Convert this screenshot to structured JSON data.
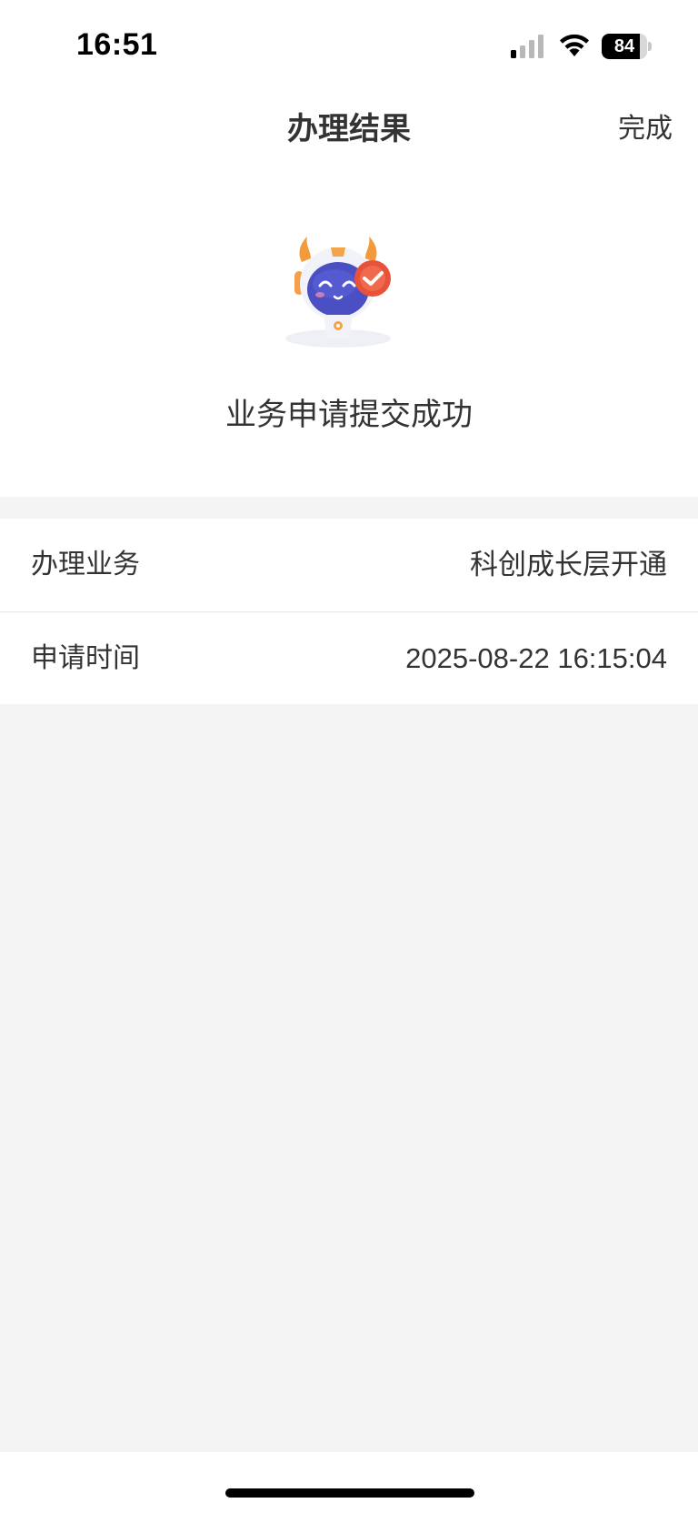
{
  "status_bar": {
    "time": "16:51",
    "battery_level": "84",
    "icons": [
      "signal-icon",
      "wifi-icon",
      "battery-icon"
    ]
  },
  "nav": {
    "title": "办理结果",
    "done_label": "完成"
  },
  "result": {
    "message": "业务申请提交成功",
    "icon": "mascot-success-icon"
  },
  "info": {
    "rows": [
      {
        "label": "办理业务",
        "value": "科创成长层开通"
      },
      {
        "label": "申请时间",
        "value": "2025-08-22 16:15:04"
      }
    ]
  },
  "colors": {
    "text": "#333333",
    "background": "#f4f4f4",
    "accent": "#e8523a",
    "mascot_face": "#4a4fc4"
  }
}
